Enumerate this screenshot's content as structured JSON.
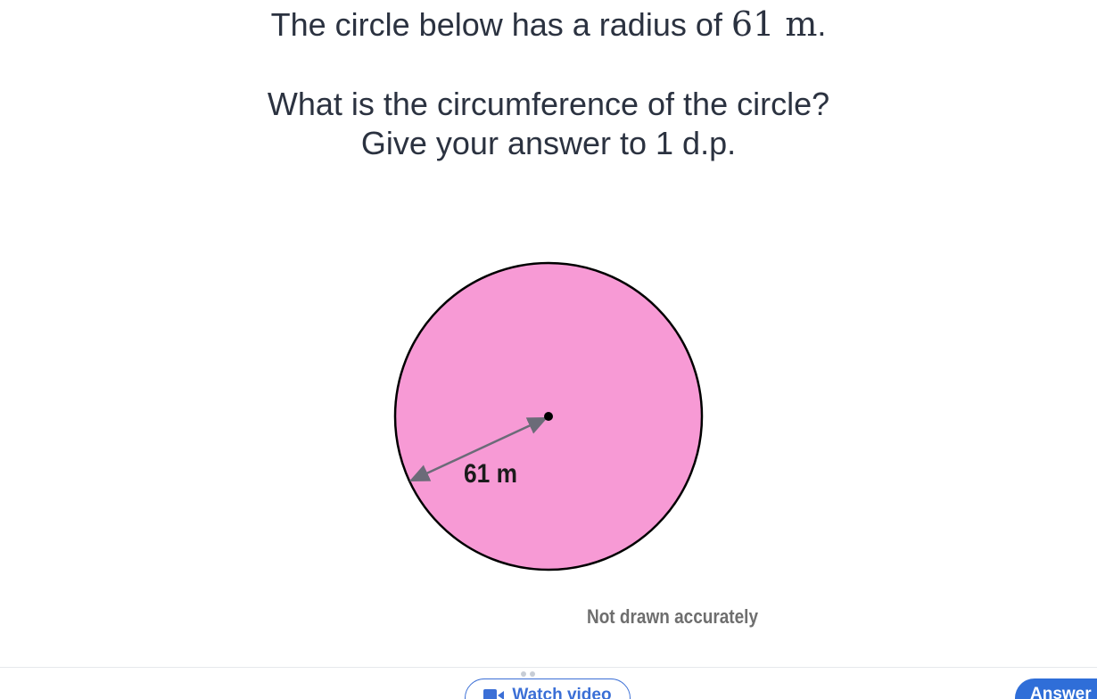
{
  "question": {
    "line1_prefix": "The circle below has a radius of ",
    "line1_math": "61 m",
    "line1_suffix": ".",
    "line2": "What is the circumference of the circle?",
    "line3": "Give your answer to 1 d.p."
  },
  "diagram": {
    "shape": "circle",
    "fill_color": "#f79ad5",
    "stroke_color": "#000000",
    "radius_label": "61 m",
    "note": "Not drawn accurately"
  },
  "footer": {
    "watch_video_label": "Watch video",
    "answer_label": "Answer",
    "watch_icon": "video-camera-icon"
  },
  "colors": {
    "text": "#2b3240",
    "accent": "#2f6ed8",
    "arrow": "#6b6b78"
  }
}
